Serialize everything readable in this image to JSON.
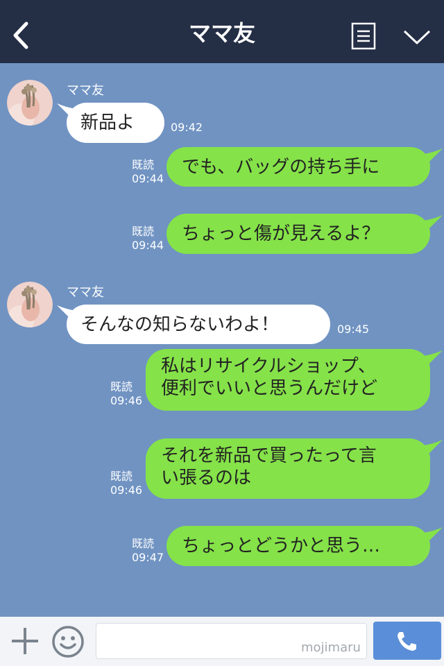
{
  "header": {
    "title": "ママ友"
  },
  "messages": [
    {
      "sender": "ママ友",
      "text": "新品よ",
      "time": "09:42"
    },
    {
      "text": "でも、バッグの持ち手に",
      "read": "既読",
      "time": "09:44"
    },
    {
      "text": "ちょっと傷が見えるよ？",
      "read": "既読",
      "time": "09:44"
    },
    {
      "sender": "ママ友",
      "text": "そんなの知らないわよ！",
      "time": "09:45"
    },
    {
      "lines": [
        "私はリサイクルショップ、",
        "便利でいいと思うんだけど"
      ],
      "read": "既読",
      "time": "09:46"
    },
    {
      "lines": [
        "それを新品で買ったって言",
        "い張るのは"
      ],
      "read": "既読",
      "time": "09:46"
    },
    {
      "text": "ちょっとどうかと思う…",
      "read": "既読",
      "time": "09:47"
    }
  ],
  "input": {
    "value": "",
    "watermark": "mojimaru"
  },
  "colors": {
    "header": "#242e45",
    "chat_background": "#7093c2",
    "outgoing_bubble": "#85e249",
    "incoming_bubble": "#ffffff",
    "call_button": "#5a8ed9"
  },
  "icons": [
    "back-arrow-icon",
    "menu-icon",
    "chevron-down-icon",
    "plus-icon",
    "emoji-icon",
    "phone-icon"
  ]
}
